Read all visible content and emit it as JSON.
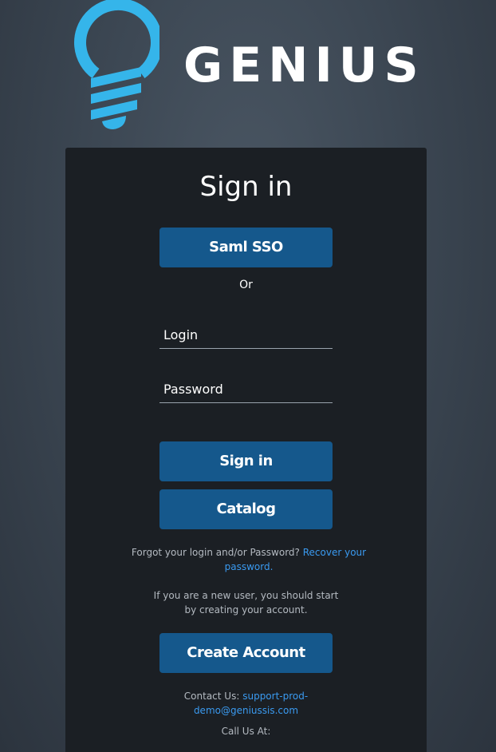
{
  "logo": {
    "text": "GENIUS",
    "icon": "lightbulb-logo-icon",
    "accent_color": "#35b5ea"
  },
  "card": {
    "title": "Sign in",
    "saml_button": "Saml SSO",
    "or_text": "Or",
    "login_placeholder": "Login",
    "password_placeholder": "Password",
    "signin_button": "Sign in",
    "catalog_button": "Catalog",
    "forgot_text": "Forgot your login and/or Password?",
    "recover_link": "Recover your password.",
    "new_user_text": "If you are a new user, you should start by creating your account.",
    "create_account_button": "Create Account",
    "contact_label": "Contact Us:",
    "contact_email": "support-prod-demo@geniussis.com",
    "call_label": "Call Us At:"
  },
  "colors": {
    "button": "#15588c",
    "link": "#3a9af0",
    "card_bg": "#1b1f24"
  }
}
